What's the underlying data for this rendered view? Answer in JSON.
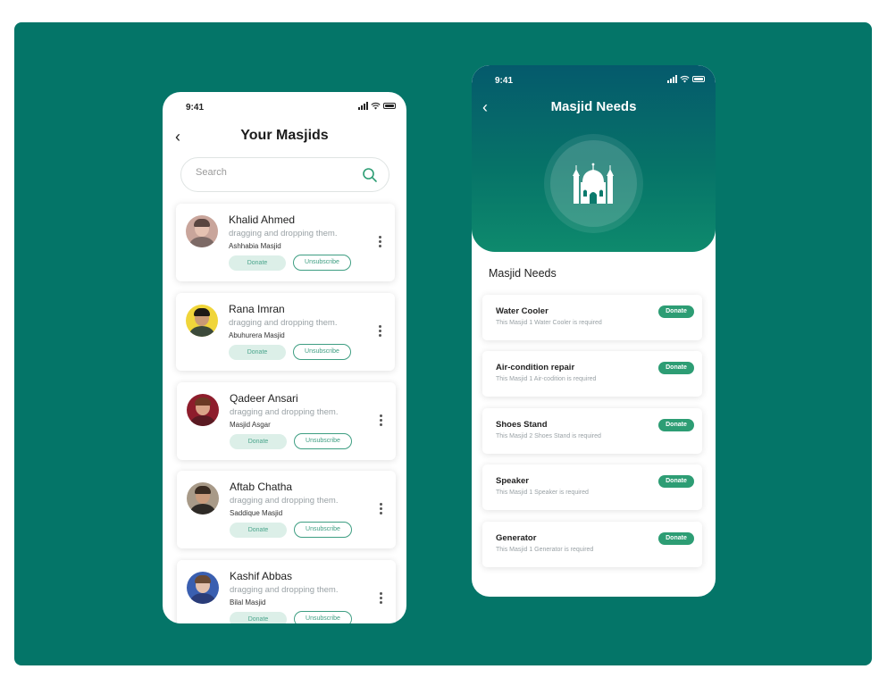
{
  "left_screen": {
    "status": {
      "time": "9:41"
    },
    "title": "Your Masjids",
    "search": {
      "placeholder": "Search",
      "value": ""
    },
    "cards": [
      {
        "name": "Khalid Ahmed",
        "desc": "dragging and dropping them.",
        "masjid": "Ashhabia Masjid",
        "donate": "Donate",
        "unsubscribe": "Unsubscribe"
      },
      {
        "name": "Rana Imran",
        "desc": "dragging and dropping them.",
        "masjid": "Abuhurera Masjid",
        "donate": "Donate",
        "unsubscribe": "Unsubscribe"
      },
      {
        "name": "Qadeer Ansari",
        "desc": "dragging and dropping them.",
        "masjid": "Masjid Asgar",
        "donate": "Donate",
        "unsubscribe": "Unsubscribe"
      },
      {
        "name": "Aftab Chatha",
        "desc": "dragging and dropping them.",
        "masjid": "Saddique Masjid",
        "donate": "Donate",
        "unsubscribe": "Unsubscribe"
      },
      {
        "name": "Kashif Abbas",
        "desc": "dragging and dropping them.",
        "masjid": "Bilal Masjid",
        "donate": "Donate",
        "unsubscribe": "Unsubscribe"
      }
    ]
  },
  "right_screen": {
    "status": {
      "time": "9:41"
    },
    "title": "Masjid Needs",
    "section_title": "Masjid Needs",
    "needs": [
      {
        "name": "Water Cooler",
        "desc": "This Masjid 1 Water Cooler is required",
        "donate": "Donate"
      },
      {
        "name": "Air-condition repair",
        "desc": "This Masjid 1 Air-codition is required",
        "donate": "Donate"
      },
      {
        "name": "Shoes Stand",
        "desc": "This Masjid 2 Shoes Stand is required",
        "donate": "Donate"
      },
      {
        "name": "Speaker",
        "desc": "This Masjid 1 Speaker is required",
        "donate": "Donate"
      },
      {
        "name": "Generator",
        "desc": "This Masjid 1 Generator is required",
        "donate": "Donate"
      }
    ]
  },
  "colors": {
    "background": "#047568",
    "accent": "#2d9d74",
    "header_gradient_top": "#055a6c",
    "header_gradient_bottom": "#0e8a6d"
  },
  "icons": [
    "back-arrow-icon",
    "search-icon",
    "more-vert-icon",
    "signal-icon",
    "wifi-icon",
    "battery-icon",
    "mosque-icon"
  ]
}
